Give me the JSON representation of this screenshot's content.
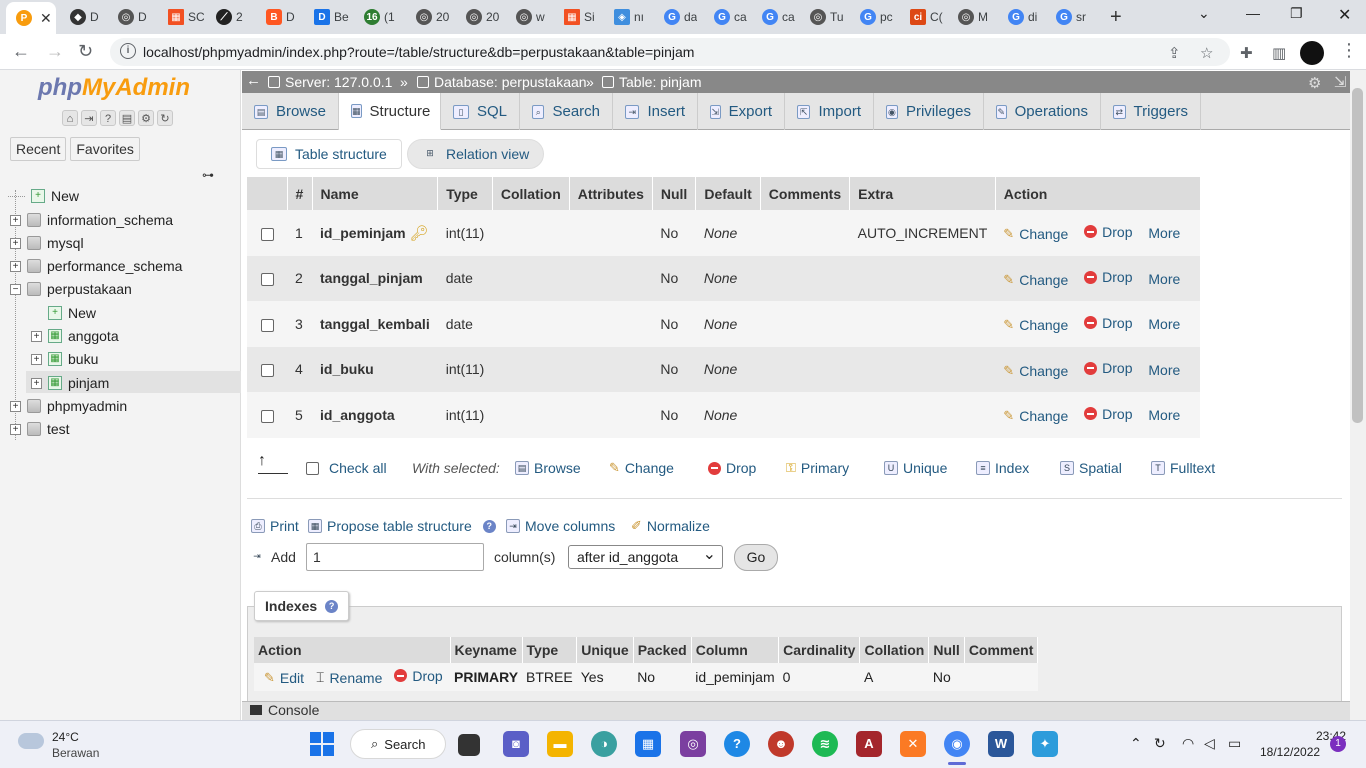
{
  "browser": {
    "tabs": [
      {
        "icon": "pma-favicon",
        "label": "",
        "color": "#f89c0e",
        "active": true
      },
      {
        "icon": "d-favicon",
        "label": "D",
        "color": "#333"
      },
      {
        "icon": "globe-favicon",
        "label": "D",
        "color": "#555"
      },
      {
        "icon": "ms-favicon",
        "label": "SC",
        "color": "#f25022"
      },
      {
        "icon": "code-favicon",
        "label": "2",
        "color": "#222"
      },
      {
        "icon": "blogger-favicon",
        "label": "D",
        "color": "#ff5722"
      },
      {
        "icon": "do-favicon",
        "label": "Be",
        "color": "#1a73e8"
      },
      {
        "icon": "number-favicon",
        "label": "(1",
        "color": "#2e7d32"
      },
      {
        "icon": "globe-favicon",
        "label": "20",
        "color": "#555"
      },
      {
        "icon": "globe-favicon",
        "label": "20",
        "color": "#555"
      },
      {
        "icon": "globe-favicon",
        "label": "w",
        "color": "#555"
      },
      {
        "icon": "ms-favicon",
        "label": "Si",
        "color": "#f25022"
      },
      {
        "icon": "cube-favicon",
        "label": "nı",
        "color": "#3f8ede"
      },
      {
        "icon": "google-favicon",
        "label": "da",
        "color": "#4285f4"
      },
      {
        "icon": "google-favicon",
        "label": "ca",
        "color": "#4285f4"
      },
      {
        "icon": "google-favicon",
        "label": "ca",
        "color": "#4285f4"
      },
      {
        "icon": "globe-favicon",
        "label": "Tu",
        "color": "#555"
      },
      {
        "icon": "google-favicon",
        "label": "pc",
        "color": "#4285f4"
      },
      {
        "icon": "ci-favicon",
        "label": "C(",
        "color": "#dd4814"
      },
      {
        "icon": "globe-favicon",
        "label": "M",
        "color": "#555"
      },
      {
        "icon": "google-favicon",
        "label": "di",
        "color": "#4285f4"
      },
      {
        "icon": "google-favicon",
        "label": "sr",
        "color": "#4285f4"
      }
    ],
    "url": "localhost/phpmyadmin/index.php?route=/table/structure&db=perpustakaan&table=pinjam"
  },
  "sidebar": {
    "logo_php": "php",
    "logo_my": "MyAdmin",
    "tabs": [
      "Recent",
      "Favorites"
    ],
    "tree": {
      "new": "New",
      "information_schema": "information_schema",
      "mysql": "mysql",
      "performance_schema": "performance_schema",
      "perpustakaan": "perpustakaan",
      "perp_new": "New",
      "anggota": "anggota",
      "buku": "buku",
      "pinjam": "pinjam",
      "phpmyadmin": "phpmyadmin",
      "test": "test"
    }
  },
  "breadcrumb": {
    "server": "Server: 127.0.0.1",
    "database": "Database: perpustakaan",
    "table": "Table: pinjam",
    "sep": "»"
  },
  "menu": {
    "browse": "Browse",
    "structure": "Structure",
    "sql": "SQL",
    "search": "Search",
    "insert": "Insert",
    "export": "Export",
    "import": "Import",
    "privileges": "Privileges",
    "operations": "Operations",
    "triggers": "Triggers"
  },
  "subtabs": {
    "table_structure": "Table structure",
    "relation_view": "Relation view"
  },
  "structure": {
    "headers": {
      "num": "#",
      "name": "Name",
      "type": "Type",
      "collation": "Collation",
      "attributes": "Attributes",
      "null": "Null",
      "default": "Default",
      "comments": "Comments",
      "extra": "Extra",
      "action": "Action"
    },
    "rows": [
      {
        "num": "1",
        "name": "id_peminjam",
        "type": "int(11)",
        "null": "No",
        "default": "None",
        "extra": "AUTO_INCREMENT",
        "primary": true
      },
      {
        "num": "2",
        "name": "tanggal_pinjam",
        "type": "date",
        "null": "No",
        "default": "None",
        "extra": ""
      },
      {
        "num": "3",
        "name": "tanggal_kembali",
        "type": "date",
        "null": "No",
        "default": "None",
        "extra": ""
      },
      {
        "num": "4",
        "name": "id_buku",
        "type": "int(11)",
        "null": "No",
        "default": "None",
        "extra": ""
      },
      {
        "num": "5",
        "name": "id_anggota",
        "type": "int(11)",
        "null": "No",
        "default": "None",
        "extra": ""
      }
    ],
    "actions": {
      "change": "Change",
      "drop": "Drop",
      "more": "More"
    }
  },
  "bulk": {
    "check_all": "Check all",
    "with_selected": "With selected:",
    "browse": "Browse",
    "change": "Change",
    "drop": "Drop",
    "primary": "Primary",
    "unique": "Unique",
    "index": "Index",
    "spatial": "Spatial",
    "fulltext": "Fulltext"
  },
  "tools": {
    "print": "Print",
    "propose": "Propose table structure",
    "move": "Move columns",
    "normalize": "Normalize",
    "add": "Add",
    "add_value": "1",
    "columns": "column(s)",
    "after": "after id_anggota",
    "go": "Go"
  },
  "indexes": {
    "title": "Indexes",
    "headers": {
      "action": "Action",
      "keyname": "Keyname",
      "type": "Type",
      "unique": "Unique",
      "packed": "Packed",
      "column": "Column",
      "cardinality": "Cardinality",
      "collation": "Collation",
      "null": "Null",
      "comment": "Comment"
    },
    "row": {
      "edit": "Edit",
      "rename": "Rename",
      "drop": "Drop",
      "keyname": "PRIMARY",
      "type": "BTREE",
      "unique": "Yes",
      "packed": "No",
      "column": "id_peminjam",
      "cardinality": "0",
      "collation": "A",
      "null": "No",
      "comment": ""
    }
  },
  "console": "Console",
  "taskbar": {
    "temp": "24°C",
    "weather": "Berawan",
    "search": "Search",
    "time": "23:42",
    "date": "18/12/2022",
    "notif": "1"
  }
}
